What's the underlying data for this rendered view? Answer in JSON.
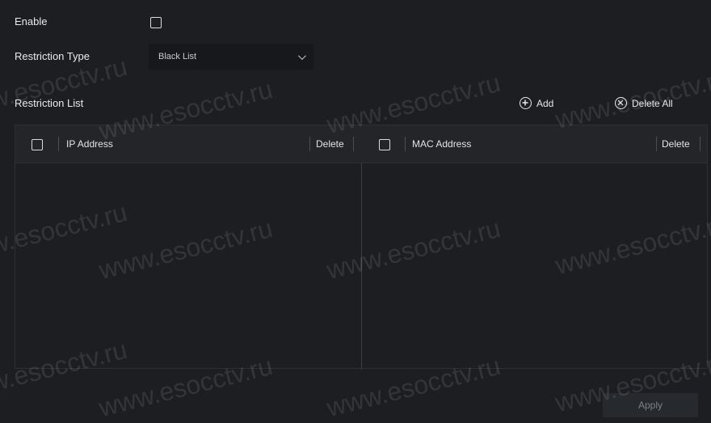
{
  "settings": {
    "enable_label": "Enable",
    "enable_checked": false,
    "restriction_type_label": "Restriction Type",
    "restriction_type_value": "Black List",
    "restriction_list_label": "Restriction List"
  },
  "actions": {
    "add_label": "Add",
    "delete_all_label": "Delete All"
  },
  "table": {
    "ip_column_header": "IP Address",
    "ip_delete_header": "Delete",
    "mac_column_header": "MAC Address",
    "mac_delete_header": "Delete",
    "ip_rows": [],
    "mac_rows": []
  },
  "footer": {
    "apply_label": "Apply"
  },
  "watermark": {
    "text": "www.esocctv.ru"
  },
  "icons": {
    "add": "plus-circle-icon",
    "delete_all": "x-circle-icon",
    "dropdown": "chevron-down-icon"
  },
  "colors": {
    "background": "#1c1e22",
    "header_bg": "#232529",
    "select_bg": "#16181b",
    "text": "#e6e8ea",
    "disabled_text": "#7e8288"
  }
}
